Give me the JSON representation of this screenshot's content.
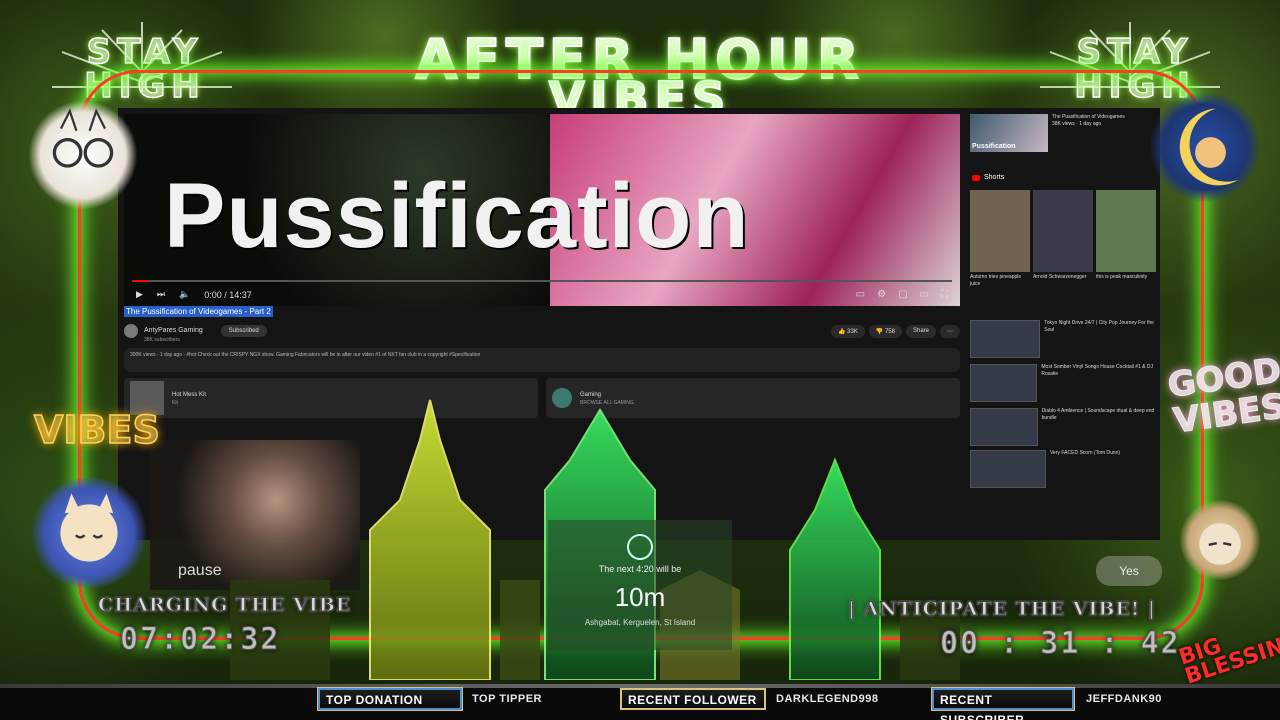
{
  "header": {
    "title_line1": "AFTER HOUR",
    "title_line2": "VIBES",
    "stay_left": "STAY HIGH",
    "stay_right": "STAY HIGH"
  },
  "video": {
    "thumbnail_text": "Pussification",
    "time": "0:00 / 14:37",
    "title": "The Pussification of Videogames - Part 2",
    "channel": "AntyPares Gaming",
    "channel_subs": "38K subscribers",
    "subscribe_label": "Subscribed",
    "likes": "33K",
    "dislikes": "758",
    "share_label": "Share",
    "description": "300K views · 1 day ago · #hot\nCheck out the CRISPY NGX show. Gaming Fabricators will be in after our video #1 of NXT fan club in a copyright #Specification",
    "card1_title": "Hot Mess Kit",
    "card1_sub": "Kit",
    "card2_title": "Gaming",
    "card2_sub": "BROWSE ALL GAMING"
  },
  "sidebar": {
    "top_title": "The Pussification of Videogames",
    "top_thumb": "Pussification",
    "top_meta": "38K views · 1 day ago",
    "shorts_label": "Shorts",
    "shorts": [
      {
        "title": "Autumn tries pineapple juice"
      },
      {
        "title": "Arnold Schwarzenegger"
      },
      {
        "title": "this is peak masculinity"
      }
    ],
    "recommended": [
      {
        "title": "Tokyo Night Drive 24/7 | City Pop Journey For the Soul"
      },
      {
        "title": "Most Somber Vinyl Songs House Cocktail #1 & DJ Rosalie"
      },
      {
        "title": "Diablo 4 Ambience | Soundscape ritual & deep end bundle"
      },
      {
        "title": "Very FACED Scorn (Tom Dunn)"
      }
    ]
  },
  "overlay": {
    "pause_text": "pause",
    "next_text": "The next 4:20 will be",
    "next_mins": "10m",
    "place_text": "Ashgabat, Kerguelen, St Island",
    "yes_label": "Yes",
    "vibes_badge": "VIBES",
    "good_vibes": "GOOD VIBES",
    "big_blessing": "BIG BLESSING"
  },
  "countdowns": {
    "left_label": "CHARGING THE VIBE",
    "left_time": "07:02:32",
    "right_label": "| ANTICIPATE THE VIBE! |",
    "right_time": "00 : 31 : 42"
  },
  "ticker": {
    "top_donation": "TOP DONATION",
    "top_tipper": "TOP TIPPER",
    "recent_follower": "RECENT FOLLOWER",
    "follower_name": "DARKLEGEND998",
    "recent_subscriber": "RECENT SUBSCRIBER",
    "subscriber_name": "JEFFDANK90"
  },
  "colors": {
    "frame": "#ff3a2a",
    "glow": "#6bff2a",
    "ticker_border": "#d9c27a"
  }
}
